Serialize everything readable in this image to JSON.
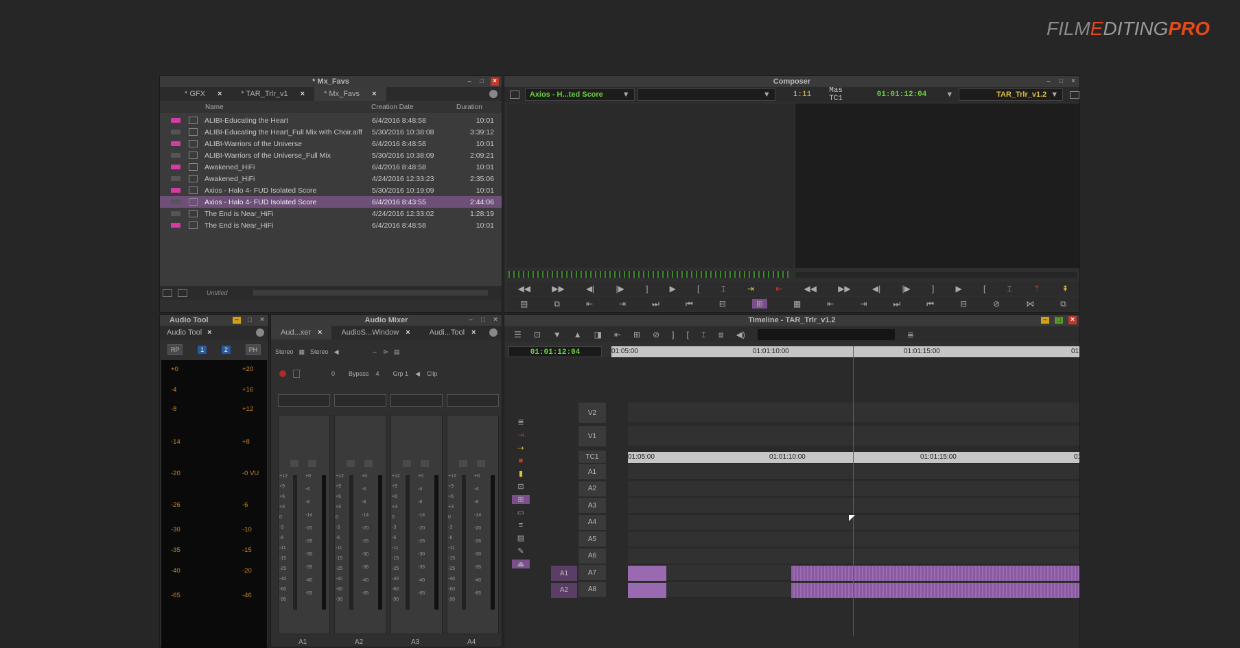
{
  "brand": {
    "film": "FILM",
    "e": "E",
    "diting": "DITING",
    "pro": "PRO"
  },
  "bin": {
    "title": "* Mx_Favs",
    "tabs": [
      {
        "label": "* GFX"
      },
      {
        "label": "* TAR_Trlr_v1"
      },
      {
        "label": "* Mx_Favs"
      }
    ],
    "close_glyph": "×",
    "columns": {
      "name": "Name",
      "date": "Creation Date",
      "duration": "Duration"
    },
    "rows": [
      {
        "name": "ALIBI-Educating the Heart",
        "date": "6/4/2016 8:48:58",
        "duration": "10:01",
        "pink": true,
        "selected": false
      },
      {
        "name": "ALIBI-Educating the Heart_Full Mix with Choir.aiff",
        "date": "5/30/2016 10:38:08",
        "duration": "3:39:12",
        "pink": false,
        "selected": false
      },
      {
        "name": "ALIBI-Warriors of the Universe",
        "date": "6/4/2016 8:48:58",
        "duration": "10:01",
        "pink": true,
        "selected": false
      },
      {
        "name": "ALIBI-Warriors of the Universe_Full Mix",
        "date": "5/30/2016 10:38:09",
        "duration": "2:09:21",
        "pink": false,
        "selected": false
      },
      {
        "name": "Awakened_HiFi",
        "date": "6/4/2016 8:48:58",
        "duration": "10:01",
        "pink": true,
        "selected": false
      },
      {
        "name": "Awakened_HiFi",
        "date": "4/24/2016 12:33:23",
        "duration": "2:35:06",
        "pink": false,
        "selected": false
      },
      {
        "name": "Axios - Halo 4- FUD Isolated Score",
        "date": "5/30/2016 10:19:09",
        "duration": "10:01",
        "pink": true,
        "selected": false
      },
      {
        "name": "Axios - Halo 4- FUD Isolated Score",
        "date": "6/4/2016 8:43:55",
        "duration": "2:44:06",
        "pink": false,
        "selected": true
      },
      {
        "name": "The End is Near_HiFi",
        "date": "4/24/2016 12:33:02",
        "duration": "1:28:19",
        "pink": false,
        "selected": false
      },
      {
        "name": "The End is Near_HiFi",
        "date": "6/4/2016 8:48:58",
        "duration": "10:01",
        "pink": true,
        "selected": false
      }
    ],
    "footer_view": "Untitled"
  },
  "composer": {
    "title": "Composer",
    "source_clip": "Axios - H...ted Score",
    "duration": "1:11",
    "tc_label": "Mas TC1",
    "timecode": "01:01:12:04",
    "sequence": "TAR_Trlr_v1.2"
  },
  "audio_tool": {
    "title": "Audio Tool",
    "tab": "Audio Tool",
    "buttons": {
      "rp": "RP",
      "ph": "PH",
      "ch1": "1",
      "ch2": "2"
    },
    "left_scale": [
      "+0",
      "-4",
      "-8",
      "-14",
      "-20",
      "-26",
      "-30",
      "-35",
      "-40",
      "-65"
    ],
    "right_scale": [
      "+20",
      "+16",
      "+12",
      "+8",
      "-0 VU",
      "-6",
      "-10",
      "-15",
      "-20",
      "-46"
    ]
  },
  "audio_mixer": {
    "title": "Audio Mixer",
    "tabs": [
      {
        "label": "Aud...xer"
      },
      {
        "label": "AudioS...Window"
      },
      {
        "label": "Audi...Tool"
      }
    ],
    "stereo1": "Stereo",
    "stereo2": "Stereo",
    "zero": "0",
    "bypass": "Bypass",
    "bypass_num": "4",
    "grp": "Grp 1",
    "clip": "Clip",
    "scale": [
      "+12",
      "+9",
      "+6",
      "+3",
      "0",
      "-3",
      "-6",
      "-11",
      "-15",
      "-25",
      "-40",
      "-60",
      "-90"
    ],
    "dbscale": [
      "+0",
      "-4",
      "-8",
      "-14",
      "-20",
      "-26",
      "-30",
      "-35",
      "-40",
      "-65"
    ],
    "channels": [
      {
        "label": "A1"
      },
      {
        "label": "A2"
      },
      {
        "label": "A3"
      },
      {
        "label": "A4"
      }
    ]
  },
  "timeline": {
    "title": "Timeline - TAR_Trlr_v1.2",
    "timecode": "01:01:12:04",
    "ruler": [
      "01:05:00",
      "01:01:10:00",
      "01:01:15:00",
      "01"
    ],
    "tc_track": "TC1",
    "video_tracks": [
      "V2",
      "V1"
    ],
    "audio_tracks": [
      "A1",
      "A2",
      "A3",
      "A4",
      "A5",
      "A6",
      "A7",
      "A8"
    ],
    "source_tracks": [
      "A1",
      "A2"
    ]
  }
}
